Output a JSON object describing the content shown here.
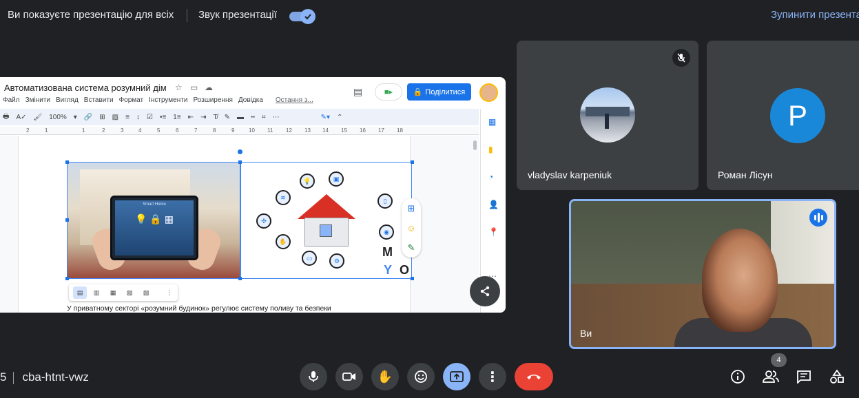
{
  "topbar": {
    "presenting_msg": "Ви показуєте презентацію для всіх",
    "sound_label": "Звук презентації",
    "stop_label": "Зупинити презента"
  },
  "doc": {
    "title": "Автоматизована система розумний дім",
    "menu": [
      "Файл",
      "Змінити",
      "Вигляд",
      "Вставити",
      "Формат",
      "Інструменти",
      "Розширення",
      "Довідка"
    ],
    "last_edit": "Остання з...",
    "share_label": "Поділитися",
    "zoom": "100%",
    "ruler": [
      "2",
      "1",
      "1",
      "2",
      "3",
      "4",
      "5",
      "6",
      "7",
      "8",
      "9",
      "10",
      "11",
      "12",
      "13",
      "14",
      "15",
      "16",
      "17",
      "18"
    ],
    "tablet_title": "Smart Home",
    "body_text": "У приватному секторі «розумний будинок» регулює систему поливу та безпеки",
    "logo_letters": [
      "M",
      "Y",
      "O"
    ]
  },
  "participants": [
    {
      "name": "vladyslav karpeniuk",
      "muted": true
    },
    {
      "name": "Роман Лісун",
      "initial": "P"
    }
  ],
  "self": {
    "name": "Ви"
  },
  "bottom": {
    "meeting_code": "cba-htnt-vwz",
    "time_fragment": "5",
    "people_count": "4"
  },
  "colors": {
    "accent": "#8ab4f8",
    "end_call": "#ea4335",
    "share_button": "#1a73e8",
    "avatar_blue": "#1a88d8"
  }
}
